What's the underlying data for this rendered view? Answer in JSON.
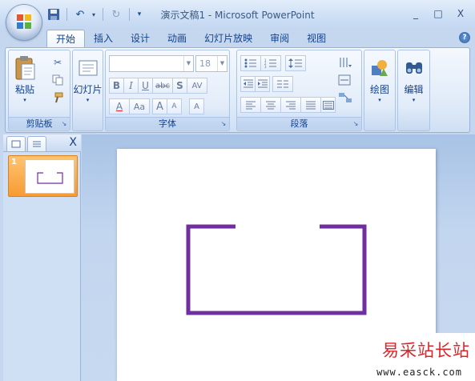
{
  "window": {
    "title": "演示文稿1 - Microsoft PowerPoint",
    "controls": {
      "minimize": "_",
      "maximize": "□",
      "close": "X"
    }
  },
  "qat": {
    "save": "save-icon",
    "undo": "↶",
    "undo_dd": "▾",
    "redo": "↻",
    "customize": "▾"
  },
  "tabs": [
    {
      "label": "开始",
      "active": true
    },
    {
      "label": "插入"
    },
    {
      "label": "设计"
    },
    {
      "label": "动画"
    },
    {
      "label": "幻灯片放映"
    },
    {
      "label": "审阅"
    },
    {
      "label": "视图"
    }
  ],
  "help": "?",
  "ribbon": {
    "clipboard": {
      "label": "剪贴板",
      "paste": "粘贴",
      "dd": "▾",
      "launcher": "↘"
    },
    "slides": {
      "new_slide": "幻灯片",
      "dd": "▾"
    },
    "font": {
      "label": "字体",
      "font_name": "",
      "font_size": "18",
      "bold": "B",
      "italic": "I",
      "underline": "U",
      "strike": "abc",
      "shadow": "S",
      "spacing": "AV",
      "color": "A",
      "case": "Aa",
      "grow": "A",
      "shrink": "A",
      "clear": "A",
      "launcher": "↘"
    },
    "paragraph": {
      "label": "段落",
      "launcher": "↘"
    },
    "drawing": {
      "label": "绘图",
      "dd": "▾"
    },
    "editing": {
      "label": "编辑",
      "dd": "▾"
    }
  },
  "slides_pane": {
    "close": "X",
    "thumbnails": [
      {
        "number": "1"
      }
    ]
  },
  "watermark": {
    "title": "易采站长站",
    "url": "www.easck.com"
  },
  "colors": {
    "accent": "#6f2f9f",
    "ribbon_text": "#15428b"
  }
}
